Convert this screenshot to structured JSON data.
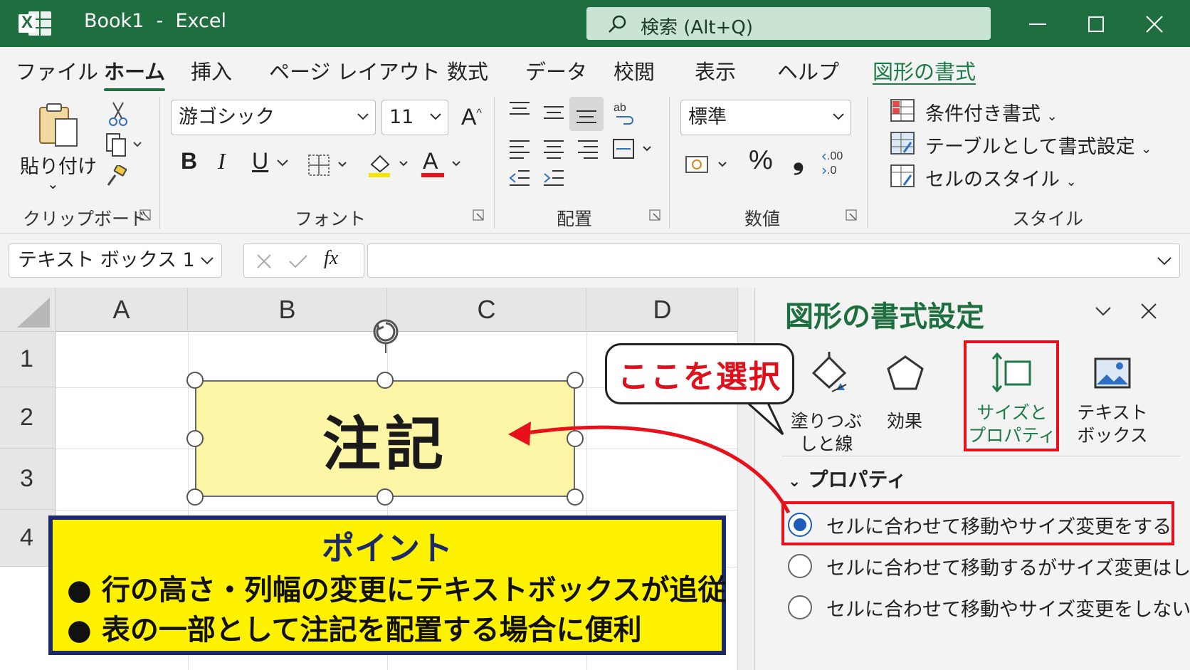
{
  "titlebar": {
    "logo_letter": "X",
    "title": "Book1  -  Excel",
    "search_placeholder": "検索 (Alt+Q)"
  },
  "tabs": [
    {
      "label": "ファイル"
    },
    {
      "label": "ホーム"
    },
    {
      "label": "挿入"
    },
    {
      "label": "ページ レイアウト"
    },
    {
      "label": "数式"
    },
    {
      "label": "データ"
    },
    {
      "label": "校閲"
    },
    {
      "label": "表示"
    },
    {
      "label": "ヘルプ"
    },
    {
      "label": "図形の書式"
    }
  ],
  "ribbon": {
    "clipboard": {
      "paste_label": "貼り付け",
      "group_label": "クリップボード"
    },
    "font": {
      "font_name": "游ゴシック",
      "font_size": "11",
      "bold": "B",
      "italic": "I",
      "underline": "U",
      "color_letter": "A",
      "group_label": "フォント",
      "grow_letter": "A"
    },
    "alignment": {
      "group_label": "配置"
    },
    "number": {
      "format": "標準",
      "percent": "%",
      "comma": "❟",
      "group_label": "数値"
    },
    "styles": {
      "conditional": "条件付き書式",
      "as_table": "テーブルとして書式設定",
      "cell_styles": "セルのスタイル",
      "group_label": "スタイル"
    }
  },
  "formula_bar": {
    "name_box": "テキスト ボックス 1",
    "fx": "fx",
    "formula": ""
  },
  "sheet": {
    "columns": [
      "A",
      "B",
      "C",
      "D"
    ],
    "rows": [
      "1",
      "2",
      "3",
      "4"
    ],
    "textbox_text": "注記"
  },
  "annotations": {
    "callout": "ここを選択",
    "point_title": "ポイント",
    "point_items": [
      "●  行の高さ・列幅の変更にテキストボックスが追従",
      "●  表の一部として注記を配置する場合に便利"
    ]
  },
  "pane": {
    "title": "図形の書式設定",
    "categories": [
      {
        "label": "塗りつぶしと線"
      },
      {
        "label": "効果"
      },
      {
        "label": "サイズと\nプロパティ"
      },
      {
        "label": "テキスト\nボックス"
      }
    ],
    "section": "プロパティ",
    "options": [
      {
        "label": "セルに合わせて移動やサイズ変更をする",
        "selected": true
      },
      {
        "label": "セルに合わせて移動するがサイズ変更はしない",
        "selected": false
      },
      {
        "label": "セルに合わせて移動やサイズ変更をしない",
        "selected": false
      }
    ]
  },
  "colors": {
    "excel_green": "#1e6e3f",
    "highlight_red": "#e8101a",
    "textbox_fill": "#fdf6a6",
    "point_fill": "#fff200",
    "point_border": "#1c2a6a",
    "radio_blue": "#1e5bb8"
  }
}
